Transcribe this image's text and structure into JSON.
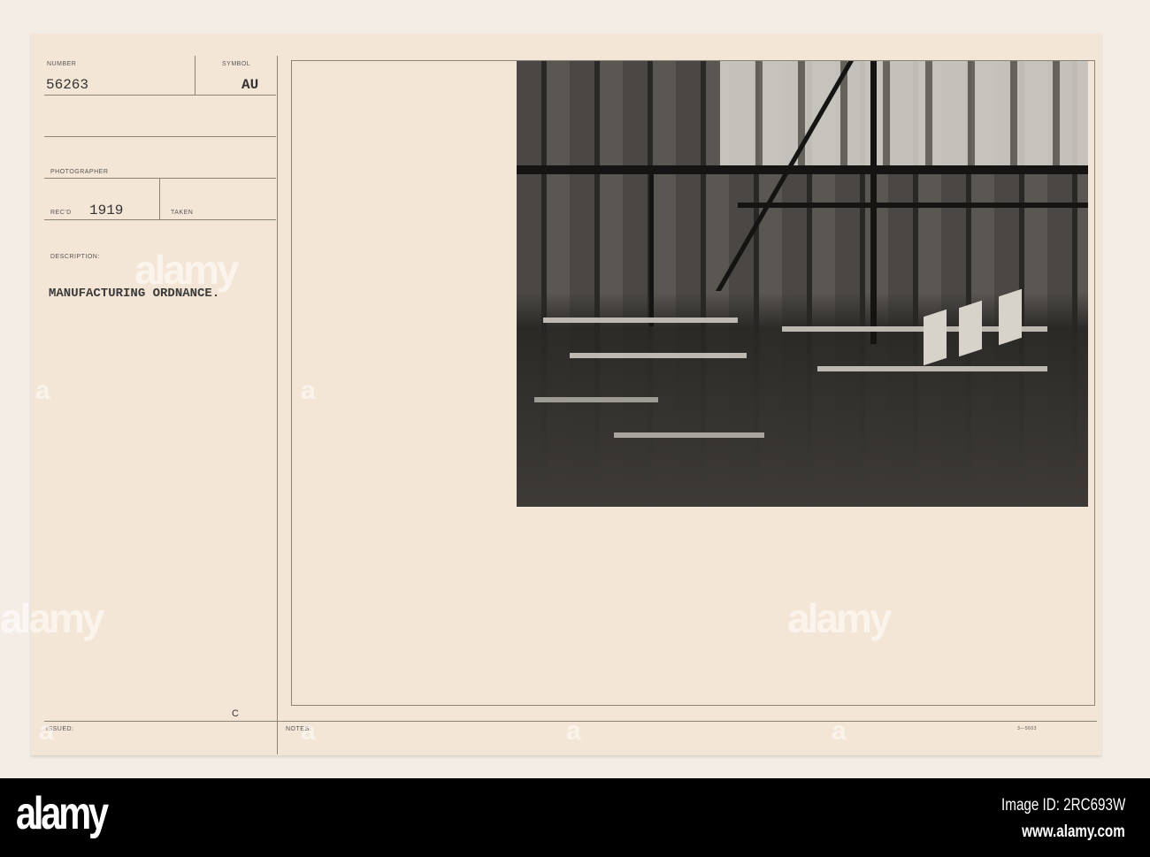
{
  "card": {
    "number_label": "NUMBER",
    "number_value": "56263",
    "symbol_label": "SYMBOL",
    "symbol_value": "AU",
    "photographer_label": "PHOTOGRAPHER",
    "recd_label": "REC'D",
    "recd_value": "1919",
    "taken_label": "TAKEN",
    "description_label": "DESCRIPTION:",
    "description_value": "MANUFACTURING ORDNANCE.",
    "issued_label": "ISSUED:",
    "issued_mark": "C",
    "notes_label": "NOTES:",
    "form_number": "3—5603"
  },
  "photo": {
    "subject": "factory-interior-photo"
  },
  "watermark": {
    "text": "alamy",
    "letter": "a"
  },
  "footer": {
    "logo": "alamy",
    "image_id": "Image ID: 2RC693W",
    "url": "www.alamy.com"
  }
}
